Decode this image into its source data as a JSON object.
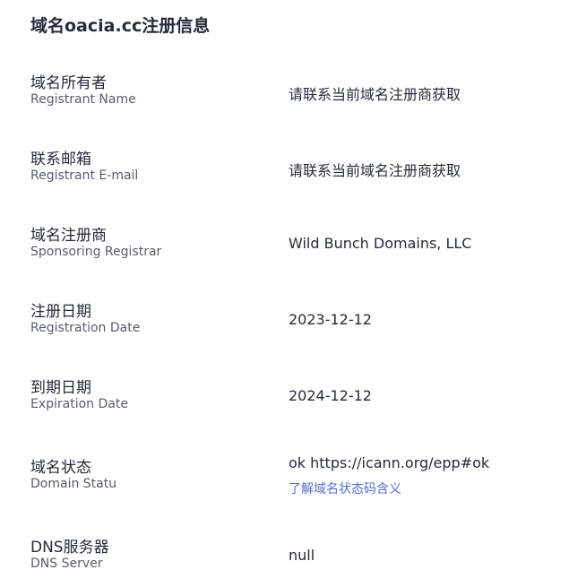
{
  "title": "域名oacia.cc注册信息",
  "rows": [
    {
      "label_zh": "域名所有者",
      "label_en": "Registrant Name",
      "value": "请联系当前域名注册商获取"
    },
    {
      "label_zh": "联系邮箱",
      "label_en": "Registrant E-mail",
      "value": "请联系当前域名注册商获取"
    },
    {
      "label_zh": "域名注册商",
      "label_en": "Sponsoring Registrar",
      "value": "Wild Bunch Domains, LLC"
    },
    {
      "label_zh": "注册日期",
      "label_en": "Registration Date",
      "value": "2023-12-12"
    },
    {
      "label_zh": "到期日期",
      "label_en": "Expiration Date",
      "value": "2024-12-12"
    },
    {
      "label_zh": "域名状态",
      "label_en": "Domain Statu",
      "value": "ok https://icann.org/epp#ok",
      "link": "了解域名状态码含义"
    },
    {
      "label_zh": "DNS服务器",
      "label_en": "DNS Server",
      "value": "null"
    }
  ]
}
